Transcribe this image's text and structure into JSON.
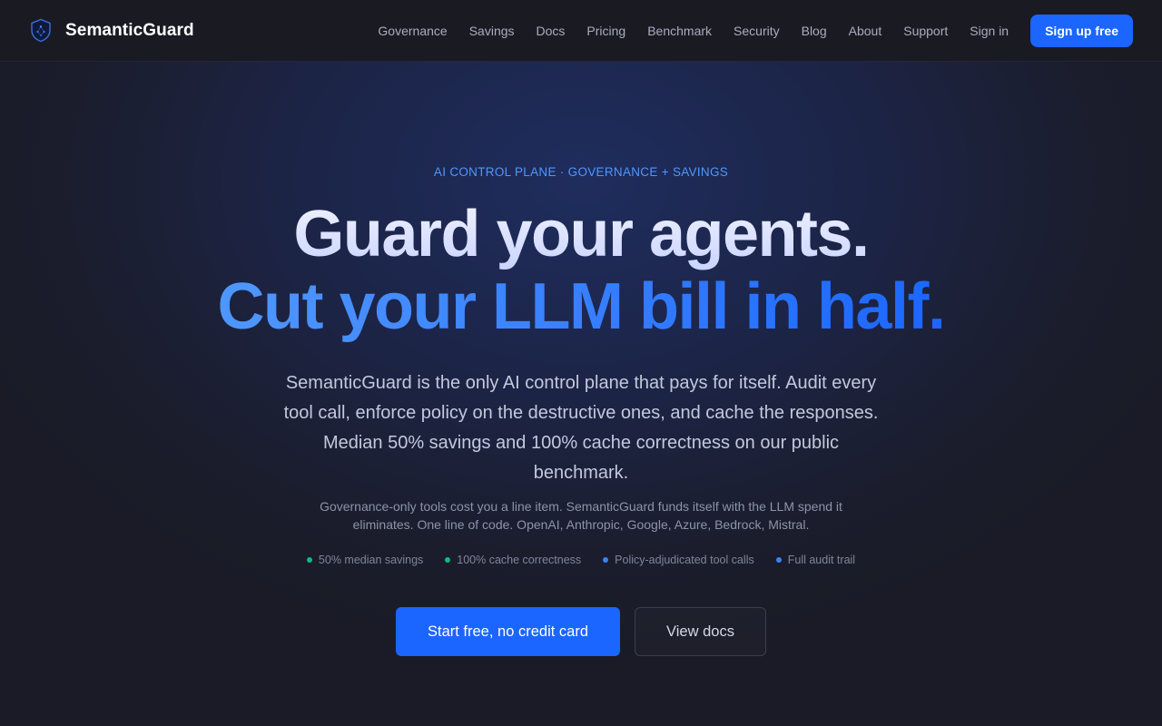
{
  "header": {
    "brand_name": "SemanticGuard",
    "brand_icon": "shield-icon",
    "nav": [
      {
        "label": "Governance"
      },
      {
        "label": "Savings"
      },
      {
        "label": "Docs"
      },
      {
        "label": "Pricing"
      },
      {
        "label": "Benchmark"
      },
      {
        "label": "Security"
      },
      {
        "label": "Blog"
      },
      {
        "label": "About"
      },
      {
        "label": "Support"
      },
      {
        "label": "Sign in"
      }
    ],
    "signup_label": "Sign up free"
  },
  "hero": {
    "eyebrow": "AI CONTROL PLANE · GOVERNANCE + SAVINGS",
    "headline_line1": "Guard your agents.",
    "headline_line2": "Cut your LLM bill in half.",
    "lead": "SemanticGuard is the only AI control plane that pays for itself. Audit every tool call, enforce policy on the destructive ones, and cache the responses. Median 50% savings and 100% cache correctness on our public benchmark.",
    "sub": "Governance-only tools cost you a line item. SemanticGuard funds itself with the LLM spend it eliminates. One line of code. OpenAI, Anthropic, Google, Azure, Bedrock, Mistral.",
    "features": [
      {
        "label": "50% median savings",
        "dot_color": "#10b981"
      },
      {
        "label": "100% cache correctness",
        "dot_color": "#10b981"
      },
      {
        "label": "Policy-adjudicated tool calls",
        "dot_color": "#3b82f6"
      },
      {
        "label": "Full audit trail",
        "dot_color": "#3b82f6"
      }
    ],
    "cta_primary": "Start free, no credit card",
    "cta_secondary": "View docs"
  },
  "colors": {
    "accent": "#1a66ff",
    "eyebrow": "#4f97ff",
    "background": "#1a1c28"
  }
}
